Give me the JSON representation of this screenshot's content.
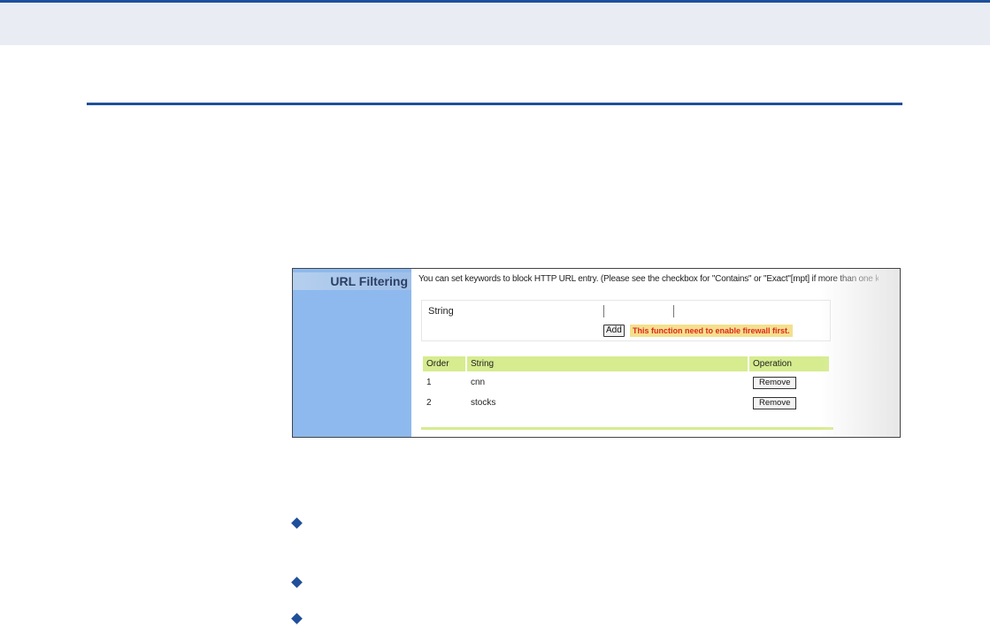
{
  "panel": {
    "title": "URL Filtering",
    "description": "You can set keywords to block HTTP URL entry. (Please see the checkbox for \"Contains\" or \"Exact\"[mpt] if more than one keyword)",
    "string_label": "String",
    "string_input_value": "",
    "add_label": "Add",
    "warning": "This function need to enable firewall first."
  },
  "table": {
    "headers": [
      "Order",
      "String",
      "Operation"
    ],
    "rows": [
      {
        "order": "1",
        "string": "cnn",
        "operation": "Remove"
      },
      {
        "order": "2",
        "string": "stocks",
        "operation": "Remove"
      }
    ]
  },
  "colors": {
    "brand_blue": "#1f4f9a",
    "sidebar_blue": "#8db9ee",
    "table_header_green": "#d6ec8f",
    "warning_red": "#e0261c",
    "warning_bg": "#f3e08e"
  },
  "icons": [
    "diamond-bullet-icon",
    "diamond-bullet-icon",
    "diamond-bullet-icon"
  ]
}
